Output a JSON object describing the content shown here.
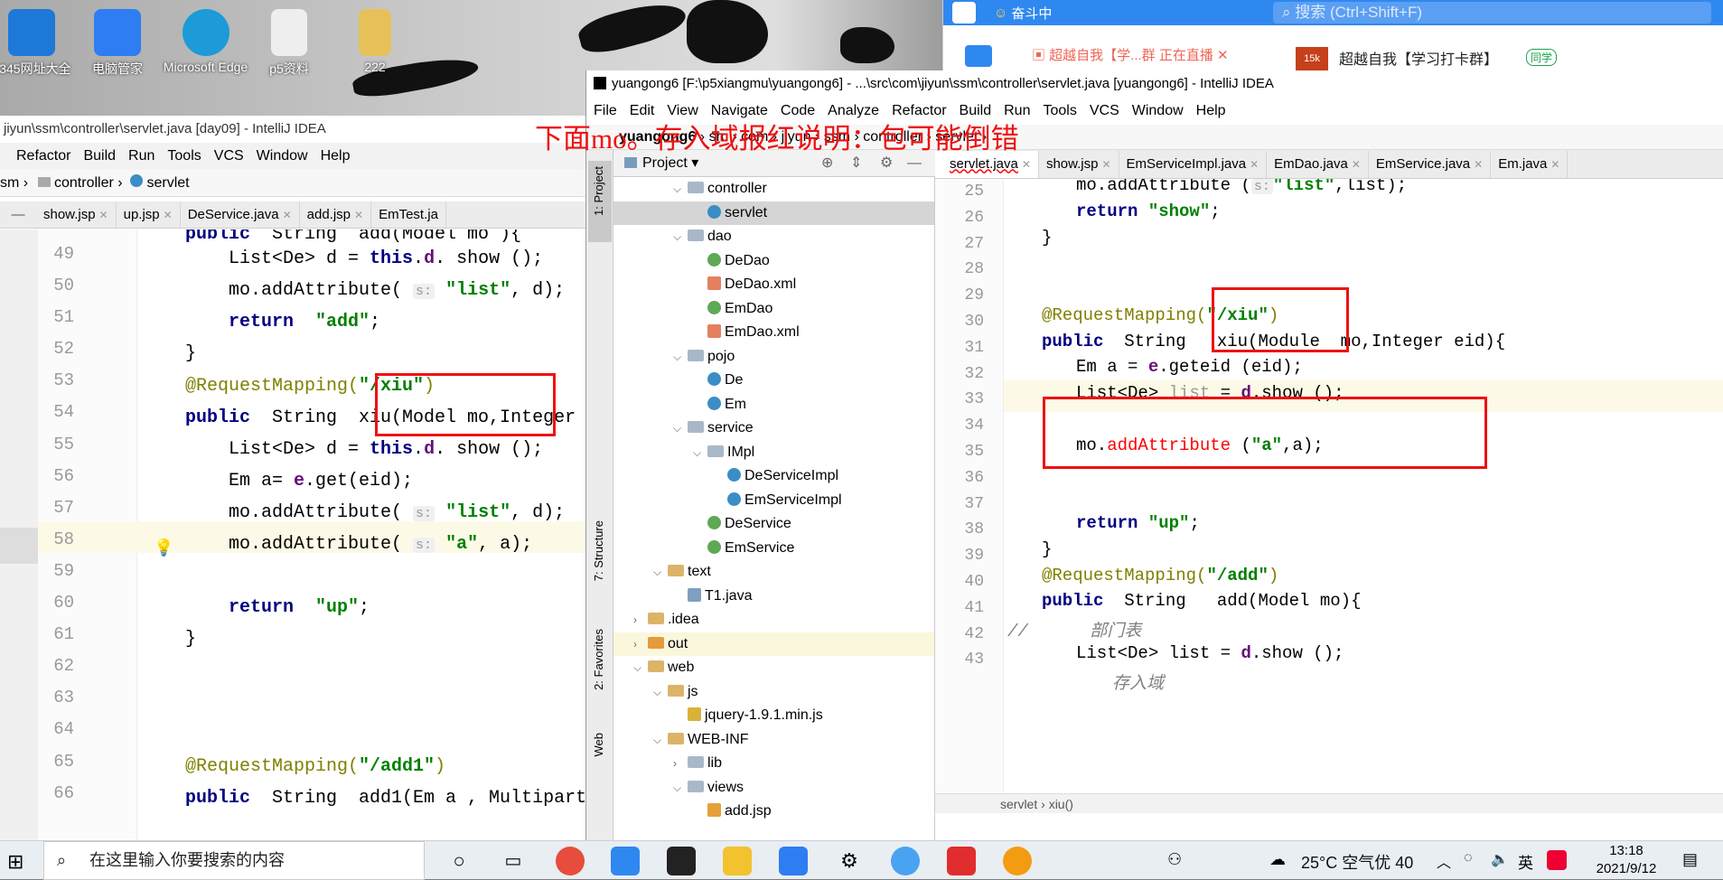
{
  "desktop": {
    "icons": [
      {
        "label": "2345网址大全",
        "color": "#1e78d8"
      },
      {
        "label": "电脑管家",
        "color": "#2e7df2"
      },
      {
        "label": "Microsoft Edge",
        "color": "#1c9bd8"
      },
      {
        "label": "p5资料",
        "color": "#e9e9e9"
      },
      {
        "label": "222",
        "color": "#e6c15a"
      }
    ]
  },
  "chat": {
    "title": "奋斗中",
    "search_placeholder": "搜索 (Ctrl+Shift+F)",
    "tab1": "超越自我【学...群 正在直播",
    "group_badge": "15k",
    "tab2": "超越自我【学习打卡群】",
    "tab2_tag": "同学"
  },
  "annotation": {
    "text": "下面mo。存入域报红说明：包可能倒错"
  },
  "ideL": {
    "title": "jiyun\\ssm\\controller\\servlet.java [day09] - IntelliJ IDEA",
    "menu": [
      "Refactor",
      "Build",
      "Run",
      "Tools",
      "VCS",
      "Window",
      "Help"
    ],
    "breadcrumb": [
      "sm",
      "controller",
      "servlet"
    ],
    "tabs": [
      "show.jsp",
      "up.jsp",
      "DeService.java",
      "add.jsp",
      "EmTest.ja"
    ],
    "line_numbers": [
      "49",
      "50",
      "51",
      "52",
      "53",
      "54",
      "55",
      "56",
      "57",
      "58",
      "59",
      "60",
      "61",
      "62",
      "63",
      "64",
      "65",
      "66"
    ],
    "code": {
      "l48": "public  String  add(Model mo ){",
      "l49a": "List<De> d = ",
      "l49b": "this",
      "l49c": ".",
      "l49d": "d",
      ". show": ". show ();",
      "l50": "mo.addAttribute(",
      "l50b": "\"list\"",
      "l50c": ", d);",
      "hint": "s:",
      "return": "return",
      "l51s": "\"add\"",
      "close": "}",
      "ann1": "@RequestMapping(",
      "ann1s": "\"/xiu\"",
      "paren": ")",
      "pub": "public",
      "l54": "  String  xiu(Model mo,Integer",
      "l56": "Em a= ",
      "l56e": "e",
      "l56b": ".get(eid);",
      "l58s": "\"a\"",
      "l58b": ", a);",
      "l60s": "\"up\"",
      "semi": ";",
      "ann2s": "\"/add1\"",
      "l66": "  String  add1(Em a , Multipart"
    }
  },
  "ideR": {
    "title": "yuangong6 [F:\\p5xiangmu\\yuangong6] - ...\\src\\com\\jiyun\\ssm\\controller\\servlet.java [yuangong6] - IntelliJ IDEA",
    "menu": [
      "File",
      "Edit",
      "View",
      "Navigate",
      "Code",
      "Analyze",
      "Refactor",
      "Build",
      "Run",
      "Tools",
      "VCS",
      "Window",
      "Help"
    ],
    "breadcrumb": [
      "yuangong6",
      "src",
      "com",
      "jiyun",
      "ssm",
      "controller",
      "servlet"
    ],
    "project_label": "Project",
    "side_tabs": [
      "1: Project",
      "7: Structure",
      "2: Favorites",
      "Web"
    ],
    "tree": [
      {
        "name": "controller",
        "type": "folder",
        "depth": 3,
        "arrow": "v"
      },
      {
        "name": "servlet",
        "type": "class",
        "depth": 4,
        "arrow": ""
      },
      {
        "name": "dao",
        "type": "folder",
        "depth": 3,
        "arrow": "v"
      },
      {
        "name": "DeDao",
        "type": "interface",
        "depth": 4,
        "arrow": ""
      },
      {
        "name": "DeDao.xml",
        "type": "xml",
        "depth": 4,
        "arrow": ""
      },
      {
        "name": "EmDao",
        "type": "interface",
        "depth": 4,
        "arrow": ""
      },
      {
        "name": "EmDao.xml",
        "type": "xml",
        "depth": 4,
        "arrow": ""
      },
      {
        "name": "pojo",
        "type": "folder",
        "depth": 3,
        "arrow": "v"
      },
      {
        "name": "De",
        "type": "class",
        "depth": 4,
        "arrow": ""
      },
      {
        "name": "Em",
        "type": "class",
        "depth": 4,
        "arrow": ""
      },
      {
        "name": "service",
        "type": "folder",
        "depth": 3,
        "arrow": "v"
      },
      {
        "name": "IMpl",
        "type": "folder",
        "depth": 4,
        "arrow": "v"
      },
      {
        "name": "DeServiceImpl",
        "type": "class",
        "depth": 5,
        "arrow": ""
      },
      {
        "name": "EmServiceImpl",
        "type": "class",
        "depth": 5,
        "arrow": ""
      },
      {
        "name": "DeService",
        "type": "interface",
        "depth": 4,
        "arrow": ""
      },
      {
        "name": "EmService",
        "type": "interface",
        "depth": 4,
        "arrow": ""
      },
      {
        "name": "text",
        "type": "folder",
        "depth": 2,
        "arrow": "v"
      },
      {
        "name": "T1.java",
        "type": "java",
        "depth": 3,
        "arrow": ""
      },
      {
        "name": ".idea",
        "type": "folder",
        "depth": 1,
        "arrow": ">"
      },
      {
        "name": "out",
        "type": "folder",
        "depth": 1,
        "arrow": ">"
      },
      {
        "name": "web",
        "type": "folder",
        "depth": 1,
        "arrow": "v"
      },
      {
        "name": "js",
        "type": "folder",
        "depth": 2,
        "arrow": "v"
      },
      {
        "name": "jquery-1.9.1.min.js",
        "type": "js",
        "depth": 3,
        "arrow": ""
      },
      {
        "name": "WEB-INF",
        "type": "folder",
        "depth": 2,
        "arrow": "v"
      },
      {
        "name": "lib",
        "type": "folder",
        "depth": 3,
        "arrow": ">"
      },
      {
        "name": "views",
        "type": "folder",
        "depth": 3,
        "arrow": "v"
      },
      {
        "name": "add.jsp",
        "type": "jsp",
        "depth": 4,
        "arrow": ""
      }
    ],
    "tabs": [
      "servlet.java",
      "show.jsp",
      "EmServiceImpl.java",
      "EmDao.java",
      "EmService.java",
      "Em.java"
    ],
    "line_numbers": [
      "25",
      "26",
      "27",
      "28",
      "29",
      "30",
      "31",
      "32",
      "33",
      "34",
      "35",
      "36",
      "37",
      "38",
      "39",
      "40",
      "41",
      "42",
      "43"
    ],
    "code": {
      "l25": "mo.addAttribute (",
      "hint": "s:",
      "l25s": "\"list\"",
      "l25b": ",list);",
      "ret": "return",
      "l26s": "\"show\"",
      "semi": ";",
      "close": "}",
      "ann": "@RequestMapping(",
      "l30s": "\"/xiu\"",
      "paren": ")",
      "pub": "public",
      "l31": "  String   xiu(Module  mo,Integer eid){",
      "l32a": "Em a = ",
      "l32e": "e",
      "l32b": ".geteid (eid);",
      "l33a": "List<De> ",
      "l33v": "list",
      "l33b": " = ",
      "l33d": "d",
      "l33c": ".show ();",
      "l35a": "mo.",
      "l35m": "addAttribute",
      "l35b": " (",
      "l35s": "\"a\"",
      "l35c": ",a);",
      "l38s": "\"up\"",
      "l40s": "\"/add\"",
      "l41": "  String   add(Model mo){",
      "l42c": "//",
      "l42": "部门表",
      "l43a": "List<De> list = ",
      "l43d": "d",
      "l43b": ".show ();",
      "l44": "存入域"
    },
    "status_crumb": [
      "servlet",
      "xiu()"
    ]
  },
  "taskbar": {
    "search_placeholder": "在这里输入你要搜索的内容",
    "weather": "25°C 空气优 40",
    "ime": "英",
    "time": "13:18",
    "date": "2021/9/12"
  }
}
